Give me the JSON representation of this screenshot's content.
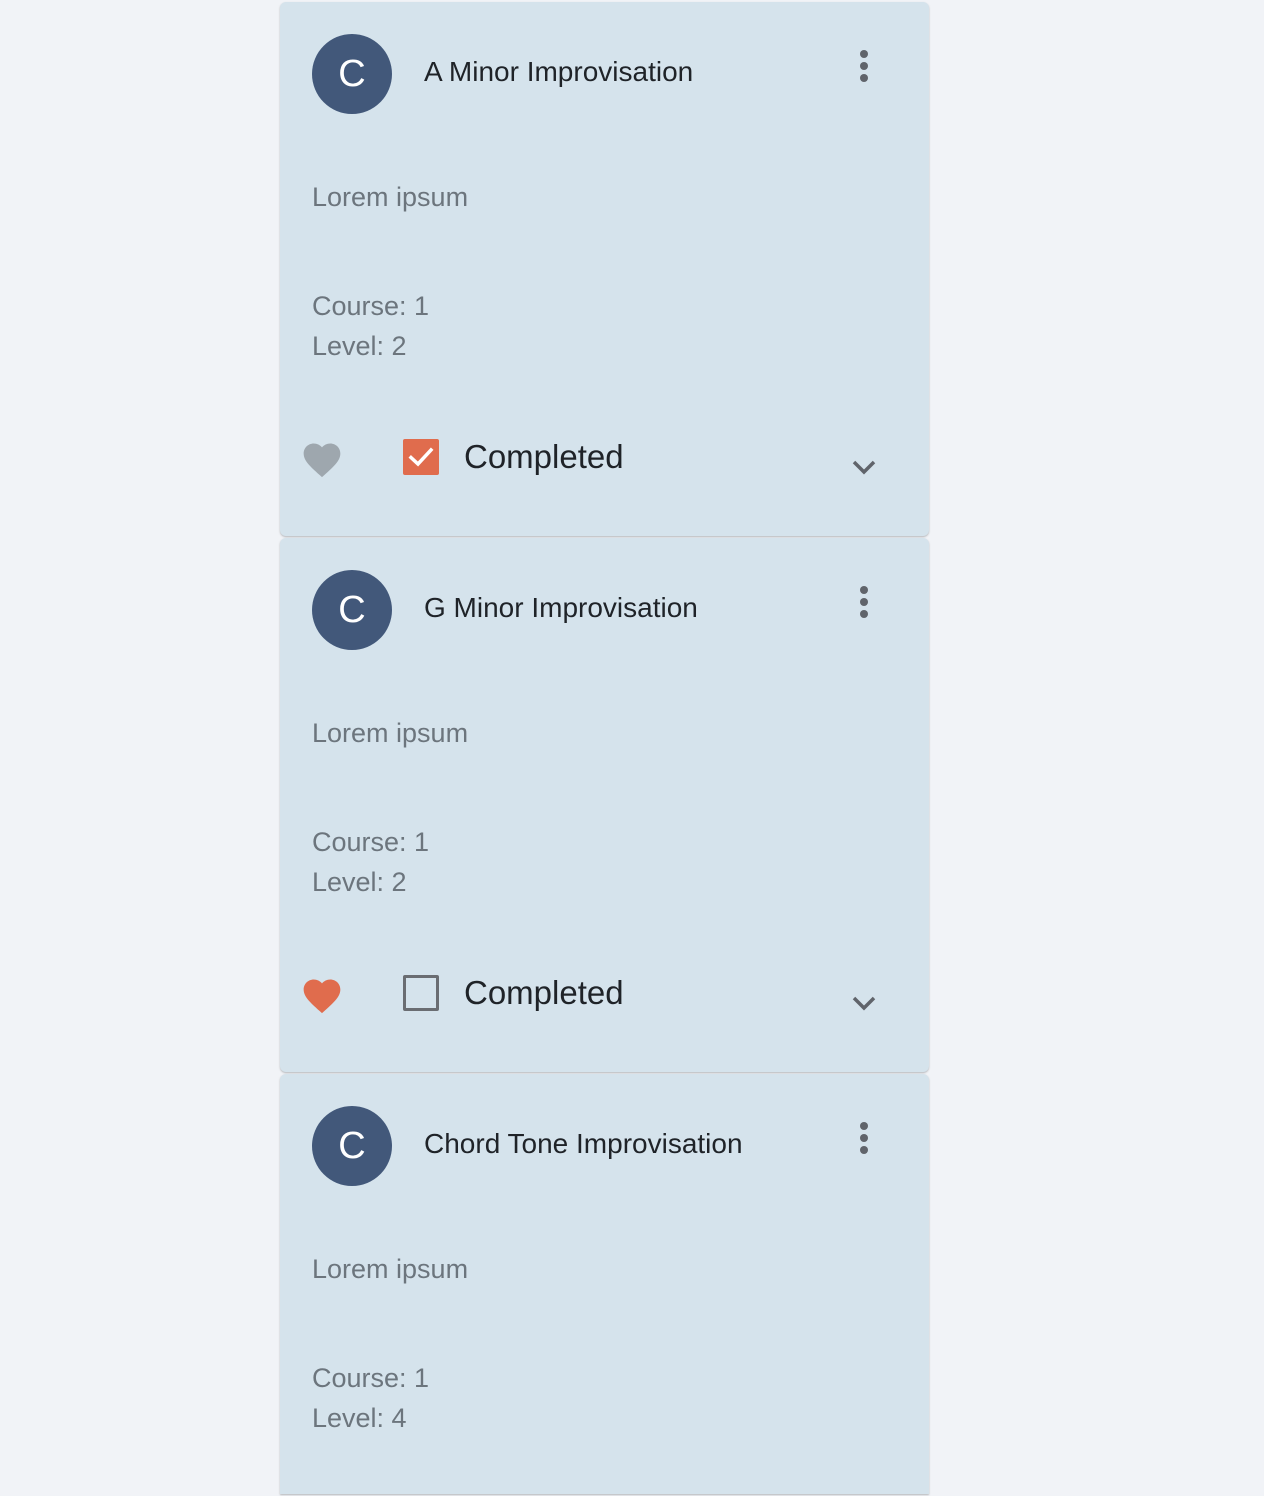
{
  "colors": {
    "page_background": "#f1f3f7",
    "card_background": "#d5e3ec",
    "avatar_background": "#42587a",
    "accent": "#e06c4d",
    "favorite_inactive": "#9ea7ae"
  },
  "cards": [
    {
      "avatar_letter": "C",
      "title": "A Minor Improvisation",
      "description": "Lorem ipsum",
      "course": "Course: 1",
      "level": "Level: 2",
      "favorite": false,
      "completed": true,
      "completed_label": "Completed"
    },
    {
      "avatar_letter": "C",
      "title": "G Minor Improvisation",
      "description": "Lorem ipsum",
      "course": "Course: 1",
      "level": "Level: 2",
      "favorite": true,
      "completed": false,
      "completed_label": "Completed"
    },
    {
      "avatar_letter": "C",
      "title": "Chord Tone Improvisation",
      "description": "Lorem ipsum",
      "course": "Course: 1",
      "level": "Level: 4"
    }
  ],
  "icons": {
    "more": "more-vert-icon",
    "favorite": "heart-icon",
    "check": "check-icon",
    "expand": "chevron-down-icon"
  }
}
